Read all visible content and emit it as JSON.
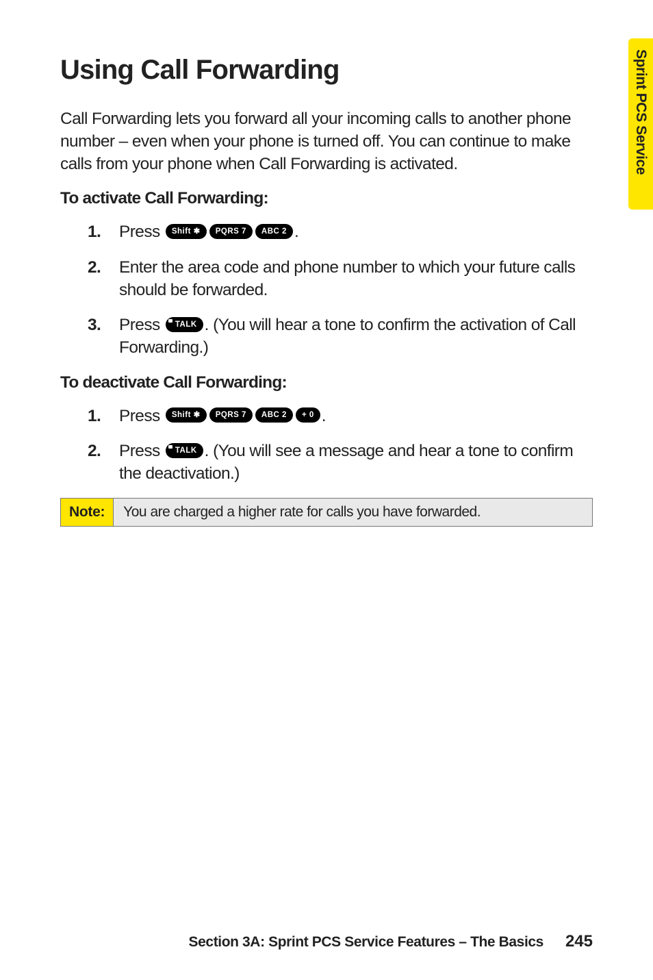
{
  "sideTab": "Sprint PCS Service",
  "title": "Using Call Forwarding",
  "intro": "Call Forwarding lets you forward all your incoming calls to another phone number – even when your phone is turned off. You can continue to make calls from your phone when Call Forwarding is activated.",
  "activate": {
    "heading": "To activate Call Forwarding:",
    "step1": {
      "num": "1.",
      "pre": "Press ",
      "post": "."
    },
    "step2": {
      "num": "2.",
      "text": "Enter the area code and phone number to which your future calls should be forwarded."
    },
    "step3": {
      "num": "3.",
      "pre": "Press ",
      "post": ". (You will hear a tone to confirm the activation of Call Forwarding.)"
    }
  },
  "deactivate": {
    "heading": "To deactivate Call Forwarding:",
    "step1": {
      "num": "1.",
      "pre": "Press ",
      "post": "."
    },
    "step2": {
      "num": "2.",
      "pre": "Press ",
      "post": ". (You will see a message and hear a tone to confirm the deactivation.)"
    }
  },
  "keys": {
    "shiftStar": "Shift ✱",
    "pqrs7": "PQRS 7",
    "abc2": "ABC 2",
    "plus0": "+ 0",
    "talk": "TALK"
  },
  "note": {
    "label": "Note:",
    "body": "You are charged a higher rate for calls you have forwarded."
  },
  "footer": {
    "section": "Section 3A: Sprint PCS Service Features – The Basics",
    "page": "245"
  }
}
